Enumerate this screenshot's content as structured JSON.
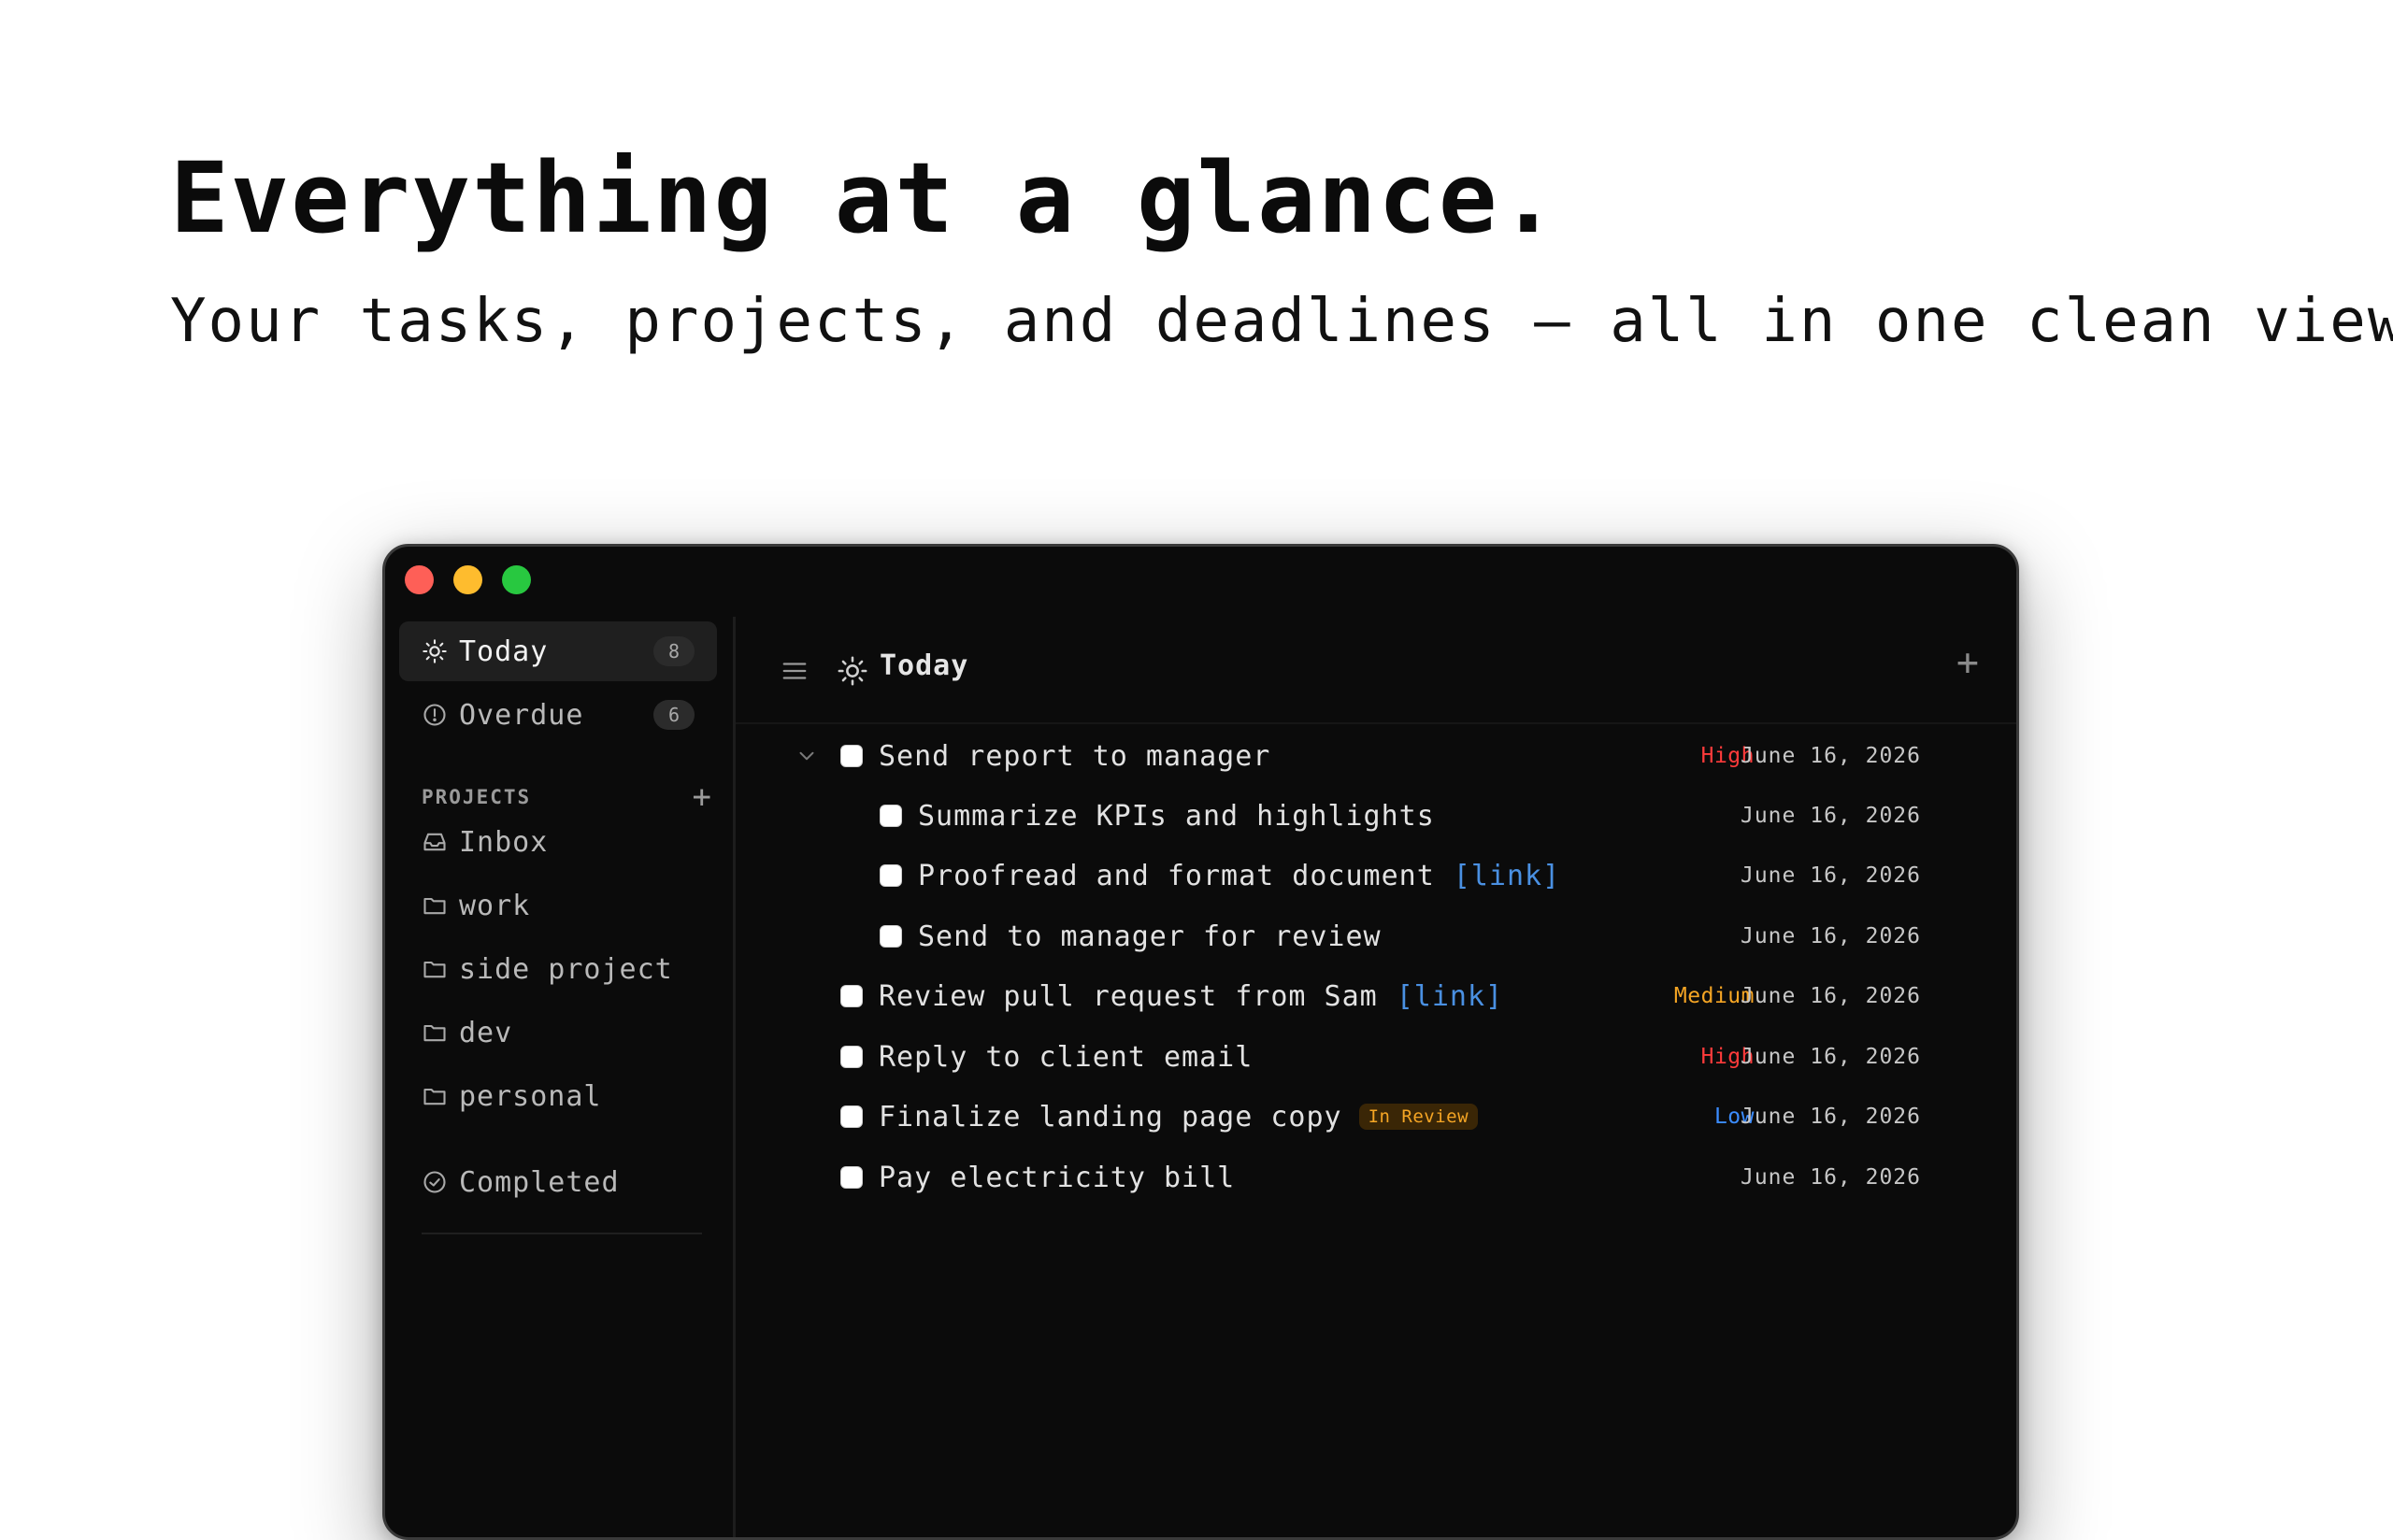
{
  "hero": {
    "title": "Everything at a glance.",
    "subtitle": "Your tasks, projects, and deadlines — all in one clean view."
  },
  "window": {
    "traffic_lights": [
      "close",
      "minimize",
      "zoom"
    ]
  },
  "sidebar": {
    "today": {
      "label": "Today",
      "count": "8",
      "icon": "sun-icon"
    },
    "overdue": {
      "label": "Overdue",
      "count": "6",
      "icon": "alert-circle-icon"
    },
    "projects_label": "PROJECTS",
    "projects_add": "+",
    "projects": [
      {
        "label": "Inbox",
        "icon": "inbox-icon"
      },
      {
        "label": "work",
        "icon": "folder-icon"
      },
      {
        "label": "side project",
        "icon": "folder-icon"
      },
      {
        "label": "dev",
        "icon": "folder-icon"
      },
      {
        "label": "personal",
        "icon": "folder-icon"
      }
    ],
    "completed": {
      "label": "Completed",
      "icon": "check-circle-icon"
    }
  },
  "main": {
    "title": "Today",
    "add": "+",
    "tasks": [
      {
        "text": "Send report to manager",
        "priority": "High",
        "date": "June 16, 2026"
      },
      {
        "text": "Summarize KPIs and highlights",
        "date": "June 16, 2026"
      },
      {
        "text": "Proofread and format document",
        "link": "[link]",
        "date": "June 16, 2026"
      },
      {
        "text": "Send to manager for review",
        "date": "June 16, 2026"
      },
      {
        "text": "Review pull request from Sam",
        "link": "[link]",
        "priority": "Medium",
        "date": "June 16, 2026"
      },
      {
        "text": "Reply to client email",
        "priority": "High",
        "date": "June 16, 2026"
      },
      {
        "text": "Finalize landing page copy",
        "tag": "In Review",
        "priority": "Low",
        "date": "June 16, 2026"
      },
      {
        "text": "Pay electricity bill",
        "date": "June 16, 2026"
      }
    ]
  },
  "colors": {
    "priority_high": "#ff3b3b",
    "priority_medium": "#f5a524",
    "priority_low": "#3b8cff",
    "link": "#4a90e2"
  }
}
